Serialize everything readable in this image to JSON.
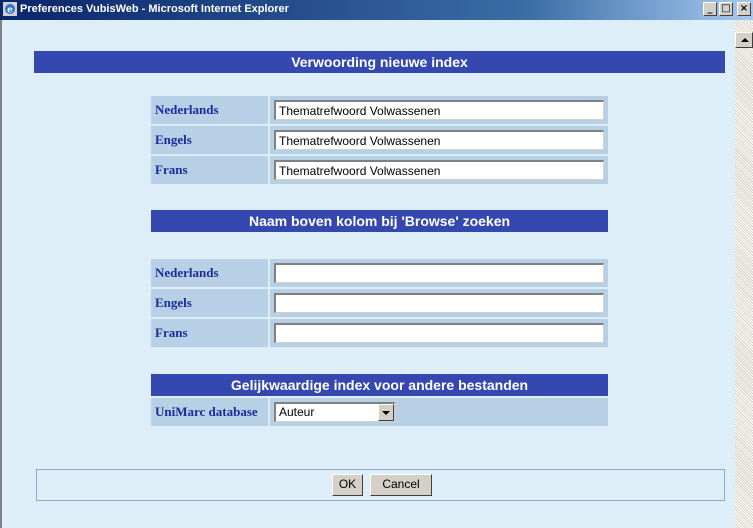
{
  "window": {
    "title": "Preferences VubisWeb - Microsoft Internet Explorer",
    "minimize": "_",
    "maximize": "□",
    "close": "×"
  },
  "section1": {
    "title": "Verwoording nieuwe index",
    "rows": [
      {
        "label": "Nederlands",
        "value": "Thematrefwoord Volwassenen"
      },
      {
        "label": "Engels",
        "value": "Thematrefwoord Volwassenen"
      },
      {
        "label": "Frans",
        "value": "Thematrefwoord Volwassenen"
      }
    ]
  },
  "section2": {
    "title": "Naam boven kolom bij 'Browse' zoeken",
    "rows": [
      {
        "label": "Nederlands",
        "value": ""
      },
      {
        "label": "Engels",
        "value": ""
      },
      {
        "label": "Frans",
        "value": ""
      }
    ]
  },
  "section3": {
    "title": "Gelijkwaardige index voor andere bestanden",
    "row": {
      "label": "UniMarc database",
      "selected": "Auteur"
    }
  },
  "buttons": {
    "ok": "OK",
    "cancel": "Cancel"
  },
  "colors": {
    "header_bar": "#3548b0",
    "label_text": "#1d2b9a",
    "row_bg": "#b7d0e6",
    "page_bg": "#ddeef9"
  },
  "icons": {
    "app": "ie-icon",
    "scroll_up": "scroll-up-arrow",
    "dropdown": "chevron-down-icon"
  }
}
